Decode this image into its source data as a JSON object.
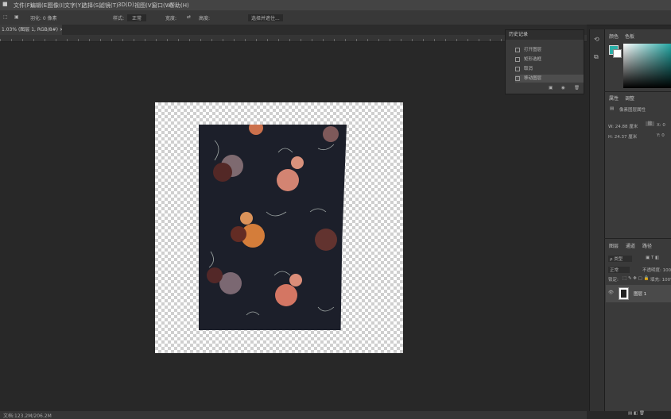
{
  "menu": [
    "文件(F)",
    "编辑(E)",
    "图像(I)",
    "文字(Y)",
    "选择(S)",
    "滤镜(T)",
    "3D(D)",
    "视图(V)",
    "窗口(W)",
    "帮助(H)"
  ],
  "options": {
    "feather": "羽化: 0 像素",
    "style_label": "样式:",
    "style_value": "正常",
    "width_label": "宽度:",
    "height_label": "高度:",
    "select_mask": "选择并遮住..."
  },
  "document_tab": "1.03% (图层 1, RGB/8#) ×",
  "history": {
    "title": "历史记录",
    "items": [
      "打开图层",
      "矩形选框",
      "取消",
      "移动图层"
    ]
  },
  "color_panel": {
    "tabs": [
      "颜色",
      "色板"
    ],
    "foreground": "#2bb0a8"
  },
  "properties": {
    "tabs": [
      "属性",
      "调整"
    ],
    "title": "像素图层属性",
    "w": "W: 24.88 厘米",
    "h": "H: 24.37 厘米",
    "x": "X: 0",
    "y": "Y: 0"
  },
  "layers_panel": {
    "tabs": [
      "图层",
      "通道",
      "路径"
    ],
    "filter": "ρ 类型",
    "mode": "正常",
    "opacity": "不透明度: 100%",
    "lock": "锁定:",
    "fill": "填充: 100%",
    "layer_name": "图层 1"
  },
  "status": "文档:123.2M/206.2M",
  "colors": {
    "accent": "#2bb0a8"
  }
}
